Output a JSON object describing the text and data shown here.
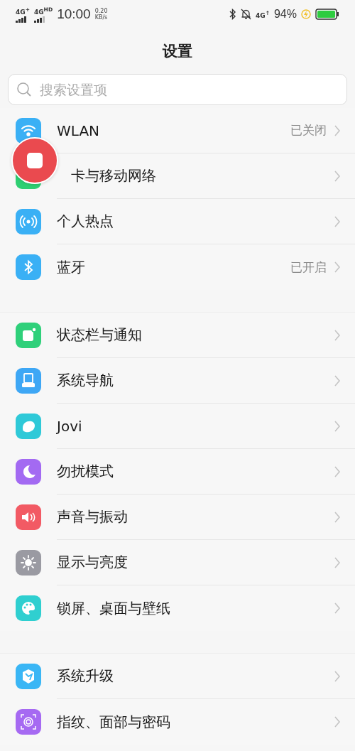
{
  "status_bar": {
    "network_1": "4G$^{+}$",
    "network_2": "4G$^{HD}$",
    "time": "10:00",
    "speed": "0.20",
    "speed_unit": "KB/s",
    "network_3": "4G$^{↑}$",
    "battery": "94%"
  },
  "title": "设置",
  "search": {
    "placeholder": "搜索设置项"
  },
  "groups": [
    {
      "items": [
        {
          "label": "WLAN",
          "value": "已关闭"
        },
        {
          "label": "卡与移动网络"
        },
        {
          "label": "个人热点"
        },
        {
          "label": "蓝牙",
          "value": "已开启"
        }
      ]
    },
    {
      "items": [
        {
          "label": "状态栏与通知"
        },
        {
          "label": "系统导航"
        },
        {
          "label": "Jovi"
        },
        {
          "label": "勿扰模式"
        },
        {
          "label": "声音与振动"
        },
        {
          "label": "显示与亮度"
        },
        {
          "label": "锁屏、桌面与壁纸"
        }
      ]
    },
    {
      "items": [
        {
          "label": "系统升级"
        },
        {
          "label": "指纹、面部与密码"
        }
      ]
    }
  ],
  "record_button": {
    "shown": true
  }
}
